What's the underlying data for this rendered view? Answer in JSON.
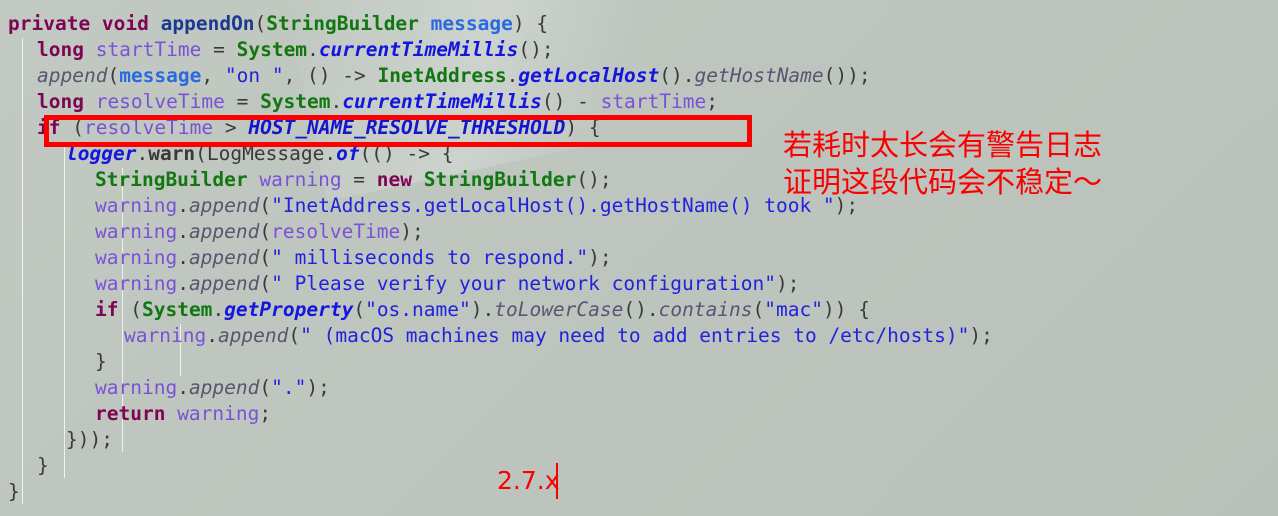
{
  "editor": {
    "background_color": "#bcc4bd",
    "font_size_px": 19.5,
    "line_height_px": 26,
    "language": "java"
  },
  "code": {
    "lines": [
      {
        "n": 1,
        "indent": 0,
        "text": "private void appendOn(StringBuilder message) {",
        "tokens": [
          {
            "t": "private void ",
            "c": "kw"
          },
          {
            "t": "appendOn",
            "c": "mdecl"
          },
          {
            "t": "(",
            "c": "plain"
          },
          {
            "t": "StringBuilder ",
            "c": "type"
          },
          {
            "t": "message",
            "c": "param"
          },
          {
            "t": ") {",
            "c": "plain"
          }
        ]
      },
      {
        "n": 2,
        "indent": 1,
        "text": "long startTime = System.currentTimeMillis();",
        "tokens": [
          {
            "t": "long ",
            "c": "kw"
          },
          {
            "t": "startTime",
            "c": "local"
          },
          {
            "t": " = ",
            "c": "plain"
          },
          {
            "t": "System",
            "c": "type"
          },
          {
            "t": ".",
            "c": "plain"
          },
          {
            "t": "currentTimeMillis",
            "c": "stat"
          },
          {
            "t": "();",
            "c": "plain"
          }
        ]
      },
      {
        "n": 3,
        "indent": 1,
        "text": "append(message, \"on \", () -> InetAddress.getLocalHost().getHostName());",
        "tokens": [
          {
            "t": "append",
            "c": "imeth"
          },
          {
            "t": "(",
            "c": "plain"
          },
          {
            "t": "message",
            "c": "param"
          },
          {
            "t": ", ",
            "c": "plain"
          },
          {
            "t": "\"on \"",
            "c": "str"
          },
          {
            "t": ", () -> ",
            "c": "plain"
          },
          {
            "t": "InetAddress",
            "c": "type"
          },
          {
            "t": ".",
            "c": "plain"
          },
          {
            "t": "getLocalHost",
            "c": "stat"
          },
          {
            "t": "().",
            "c": "plain"
          },
          {
            "t": "getHostName",
            "c": "imeth"
          },
          {
            "t": "());",
            "c": "plain"
          }
        ]
      },
      {
        "n": 4,
        "indent": 1,
        "text": "long resolveTime = System.currentTimeMillis() - startTime;",
        "tokens": [
          {
            "t": "long ",
            "c": "kw"
          },
          {
            "t": "resolveTime",
            "c": "local"
          },
          {
            "t": " = ",
            "c": "plain"
          },
          {
            "t": "System",
            "c": "type"
          },
          {
            "t": ".",
            "c": "plain"
          },
          {
            "t": "currentTimeMillis",
            "c": "stat"
          },
          {
            "t": "() - ",
            "c": "plain"
          },
          {
            "t": "startTime",
            "c": "local"
          },
          {
            "t": ";",
            "c": "plain"
          }
        ]
      },
      {
        "n": 5,
        "indent": 1,
        "text": "if (resolveTime > HOST_NAME_RESOLVE_THRESHOLD) {",
        "tokens": [
          {
            "t": "if ",
            "c": "kw"
          },
          {
            "t": "(",
            "c": "plain"
          },
          {
            "t": "resolveTime",
            "c": "local"
          },
          {
            "t": " > ",
            "c": "plain"
          },
          {
            "t": "HOST_NAME_RESOLVE_THRESHOLD",
            "c": "const"
          },
          {
            "t": ") {",
            "c": "plain"
          }
        ]
      },
      {
        "n": 6,
        "indent": 2,
        "text": "logger.warn(LogMessage.of(() -> {",
        "tokens": [
          {
            "t": "logger",
            "c": "stat"
          },
          {
            "t": ".",
            "c": "plain"
          },
          {
            "t": "warn",
            "c": "field"
          },
          {
            "t": "(",
            "c": "plain"
          },
          {
            "t": "LogMessage",
            "c": "cls"
          },
          {
            "t": ".",
            "c": "plain"
          },
          {
            "t": "of",
            "c": "stat"
          },
          {
            "t": "(() -> {",
            "c": "plain"
          }
        ]
      },
      {
        "n": 7,
        "indent": 3,
        "text": "StringBuilder warning = new StringBuilder();",
        "tokens": [
          {
            "t": "StringBuilder ",
            "c": "type"
          },
          {
            "t": "warning",
            "c": "local"
          },
          {
            "t": " = ",
            "c": "plain"
          },
          {
            "t": "new ",
            "c": "kw"
          },
          {
            "t": "StringBuilder",
            "c": "type"
          },
          {
            "t": "();",
            "c": "plain"
          }
        ]
      },
      {
        "n": 8,
        "indent": 3,
        "text": "warning.append(\"InetAddress.getLocalHost().getHostName() took \");",
        "tokens": [
          {
            "t": "warning",
            "c": "local"
          },
          {
            "t": ".",
            "c": "plain"
          },
          {
            "t": "append",
            "c": "imeth"
          },
          {
            "t": "(",
            "c": "plain"
          },
          {
            "t": "\"InetAddress.getLocalHost().getHostName() took \"",
            "c": "str"
          },
          {
            "t": ");",
            "c": "plain"
          }
        ]
      },
      {
        "n": 9,
        "indent": 3,
        "text": "warning.append(resolveTime);",
        "tokens": [
          {
            "t": "warning",
            "c": "local"
          },
          {
            "t": ".",
            "c": "plain"
          },
          {
            "t": "append",
            "c": "imeth"
          },
          {
            "t": "(",
            "c": "plain"
          },
          {
            "t": "resolveTime",
            "c": "local"
          },
          {
            "t": ");",
            "c": "plain"
          }
        ]
      },
      {
        "n": 10,
        "indent": 3,
        "text": "warning.append(\" milliseconds to respond.\");",
        "tokens": [
          {
            "t": "warning",
            "c": "local"
          },
          {
            "t": ".",
            "c": "plain"
          },
          {
            "t": "append",
            "c": "imeth"
          },
          {
            "t": "(",
            "c": "plain"
          },
          {
            "t": "\" milliseconds to respond.\"",
            "c": "str"
          },
          {
            "t": ");",
            "c": "plain"
          }
        ]
      },
      {
        "n": 11,
        "indent": 3,
        "text": "warning.append(\" Please verify your network configuration\");",
        "tokens": [
          {
            "t": "warning",
            "c": "local"
          },
          {
            "t": ".",
            "c": "plain"
          },
          {
            "t": "append",
            "c": "imeth"
          },
          {
            "t": "(",
            "c": "plain"
          },
          {
            "t": "\" Please verify your network configuration\"",
            "c": "str"
          },
          {
            "t": ");",
            "c": "plain"
          }
        ]
      },
      {
        "n": 12,
        "indent": 3,
        "text": "if (System.getProperty(\"os.name\").toLowerCase().contains(\"mac\")) {",
        "tokens": [
          {
            "t": "if ",
            "c": "kw"
          },
          {
            "t": "(",
            "c": "plain"
          },
          {
            "t": "System",
            "c": "type"
          },
          {
            "t": ".",
            "c": "plain"
          },
          {
            "t": "getProperty",
            "c": "stat"
          },
          {
            "t": "(",
            "c": "plain"
          },
          {
            "t": "\"os.name\"",
            "c": "str"
          },
          {
            "t": ").",
            "c": "plain"
          },
          {
            "t": "toLowerCase",
            "c": "imeth"
          },
          {
            "t": "().",
            "c": "plain"
          },
          {
            "t": "contains",
            "c": "imeth"
          },
          {
            "t": "(",
            "c": "plain"
          },
          {
            "t": "\"mac\"",
            "c": "str"
          },
          {
            "t": ")) {",
            "c": "plain"
          }
        ]
      },
      {
        "n": 13,
        "indent": 4,
        "text": "warning.append(\" (macOS machines may need to add entries to /etc/hosts)\");",
        "tokens": [
          {
            "t": "warning",
            "c": "local"
          },
          {
            "t": ".",
            "c": "plain"
          },
          {
            "t": "append",
            "c": "imeth"
          },
          {
            "t": "(",
            "c": "plain"
          },
          {
            "t": "\" (macOS machines may need to add entries to /etc/hosts)\"",
            "c": "str"
          },
          {
            "t": ");",
            "c": "plain"
          }
        ]
      },
      {
        "n": 14,
        "indent": 3,
        "text": "}",
        "tokens": [
          {
            "t": "}",
            "c": "plain"
          }
        ]
      },
      {
        "n": 15,
        "indent": 3,
        "text": "warning.append(\".\");",
        "tokens": [
          {
            "t": "warning",
            "c": "local"
          },
          {
            "t": ".",
            "c": "plain"
          },
          {
            "t": "append",
            "c": "imeth"
          },
          {
            "t": "(",
            "c": "plain"
          },
          {
            "t": "\".\"",
            "c": "str"
          },
          {
            "t": ");",
            "c": "plain"
          }
        ]
      },
      {
        "n": 16,
        "indent": 3,
        "text": "return warning;",
        "tokens": [
          {
            "t": "return ",
            "c": "kw"
          },
          {
            "t": "warning",
            "c": "local"
          },
          {
            "t": ";",
            "c": "plain"
          }
        ]
      },
      {
        "n": 17,
        "indent": 2,
        "text": "}));",
        "tokens": [
          {
            "t": "}));",
            "c": "plain"
          }
        ]
      },
      {
        "n": 18,
        "indent": 1,
        "text": "}",
        "tokens": [
          {
            "t": "}",
            "c": "plain"
          }
        ]
      },
      {
        "n": 19,
        "indent": 0,
        "text": "}",
        "tokens": [
          {
            "t": "}",
            "c": "plain"
          }
        ]
      }
    ]
  },
  "annotations": {
    "color": "#fb0000",
    "highlight_box": {
      "label": "red-rectangle-around-if-condition",
      "target_line": "if (resolveTime > HOST_NAME_RESOLVE_THRESHOLD) {"
    },
    "notes": [
      {
        "text": "若耗时太长会有警告日志"
      },
      {
        "text": "证明这段代码会不稳定～"
      }
    ],
    "version_label": "2.7.x"
  }
}
